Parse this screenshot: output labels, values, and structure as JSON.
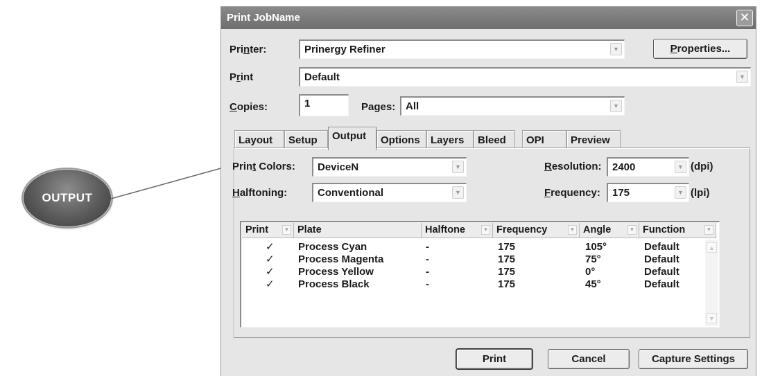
{
  "callout": {
    "label": "OUTPUT"
  },
  "window": {
    "title": "Print JobName",
    "close_glyph": "✕"
  },
  "printer": {
    "label_pre": "Pri",
    "label_u": "n",
    "label_post": "ter:",
    "value": "Prinergy Refiner"
  },
  "properties_button": {
    "label_u": "P",
    "label_post": "roperties..."
  },
  "print_preset": {
    "label_pre": "P",
    "label_u": "r",
    "label_post": "int",
    "value": "Default"
  },
  "copies": {
    "label_u": "C",
    "label_post": "opies:",
    "value": "1"
  },
  "pages": {
    "label_pre": "Pa",
    "label_u": "g",
    "label_post": "es:",
    "value": "All"
  },
  "tabs": [
    {
      "label": "Layout"
    },
    {
      "label": "Setup"
    },
    {
      "label": "Output"
    },
    {
      "label": "Options"
    },
    {
      "label": "Layers"
    },
    {
      "label": "Bleed"
    },
    {
      "label": "OPI"
    },
    {
      "label": "Preview"
    }
  ],
  "output": {
    "print_colors": {
      "label_pre": "Prin",
      "label_u": "t",
      "label_post": " Colors:",
      "value": "DeviceN"
    },
    "halftoning": {
      "label_u": "H",
      "label_post": "alftoning:",
      "value": "Conventional"
    },
    "resolution": {
      "label_u": "R",
      "label_post": "esolution:",
      "value": "2400",
      "unit": "(dpi)"
    },
    "frequency": {
      "label_u": "F",
      "label_post": "requency:",
      "value": "175",
      "unit": "(lpi)"
    }
  },
  "plates_table": {
    "columns": [
      "Print",
      "Plate",
      "Halftone",
      "Frequency",
      "Angle",
      "Function"
    ],
    "rows": [
      {
        "print": "✓",
        "plate": "Process Cyan",
        "halftone": "-",
        "frequency": "175",
        "angle": "105°",
        "function": "Default"
      },
      {
        "print": "✓",
        "plate": "Process Magenta",
        "halftone": "-",
        "frequency": "175",
        "angle": "75°",
        "function": "Default"
      },
      {
        "print": "✓",
        "plate": "Process Yellow",
        "halftone": "-",
        "frequency": "175",
        "angle": "0°",
        "function": "Default"
      },
      {
        "print": "✓",
        "plate": "Process Black",
        "halftone": "-",
        "frequency": "175",
        "angle": "45°",
        "function": "Default"
      }
    ]
  },
  "buttons": {
    "print": "Print",
    "cancel": "Cancel",
    "capture": "Capture Settings"
  },
  "glyphs": {
    "dropdown": "▼",
    "scroll_up": "▲",
    "scroll_down": "▼"
  },
  "colors": {
    "titlebar": "#7c7c7c",
    "dialog": "#e6e6e6",
    "callout": "#5a5a5a"
  }
}
